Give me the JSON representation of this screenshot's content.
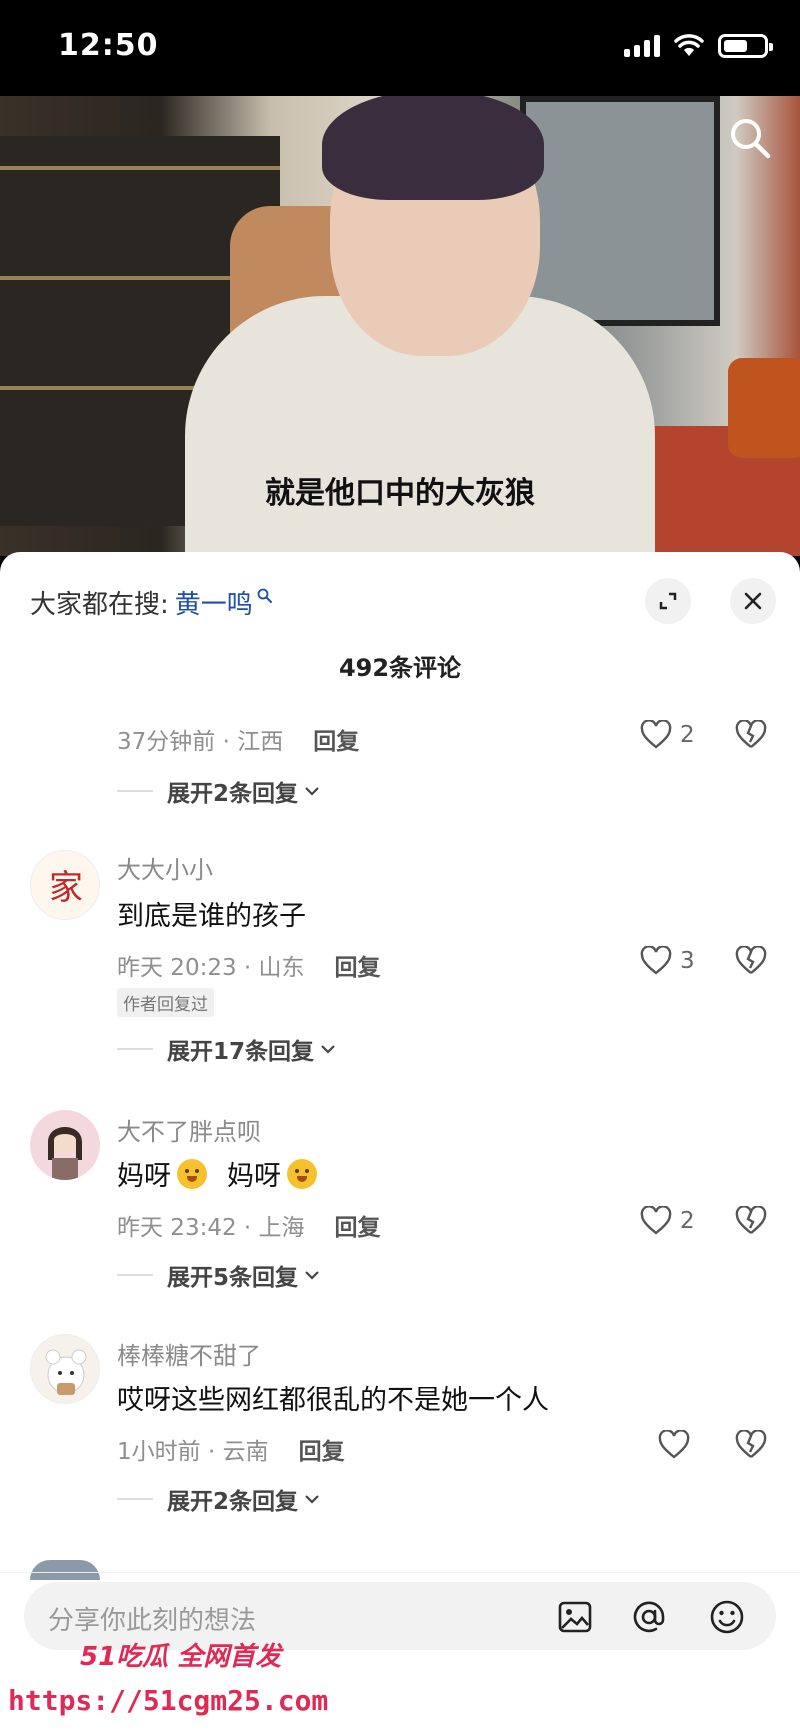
{
  "status_bar": {
    "time": "12:50"
  },
  "video": {
    "subtitle": "就是他口中的大灰狼"
  },
  "sheet": {
    "trending_label": "大家都在搜:",
    "trending_term": "黄一鸣",
    "comment_count": "492条评论"
  },
  "comments": [
    {
      "meta": "37分钟前 · 江西",
      "reply": "回复",
      "likes": "2",
      "expand": "展开2条回复"
    },
    {
      "username": "大大小小",
      "text": "到底是谁的孩子",
      "meta": "昨天 20:23 · 山东",
      "reply": "回复",
      "likes": "3",
      "tag": "作者回复过",
      "expand": "展开17条回复"
    },
    {
      "username": "大不了胖点呗",
      "text_a": "妈呀",
      "text_b": "妈呀",
      "meta": "昨天 23:42 · 上海",
      "reply": "回复",
      "likes": "2",
      "expand": "展开5条回复"
    },
    {
      "username": "棒棒糖不甜了",
      "text": "哎呀这些网红都很乱的不是她一个人",
      "meta": "1小时前 · 云南",
      "reply": "回复",
      "likes": "",
      "expand": "展开2条回复"
    }
  ],
  "input": {
    "placeholder": "分享你此刻的想法"
  },
  "watermark": {
    "line1": "51吃瓜 全网首发",
    "line2": "https://51cgm25.com"
  },
  "icons": [
    "search-icon",
    "expand-icon",
    "close-icon",
    "heart-icon",
    "broken-heart-icon",
    "image-icon",
    "at-icon",
    "emoji-icon"
  ]
}
